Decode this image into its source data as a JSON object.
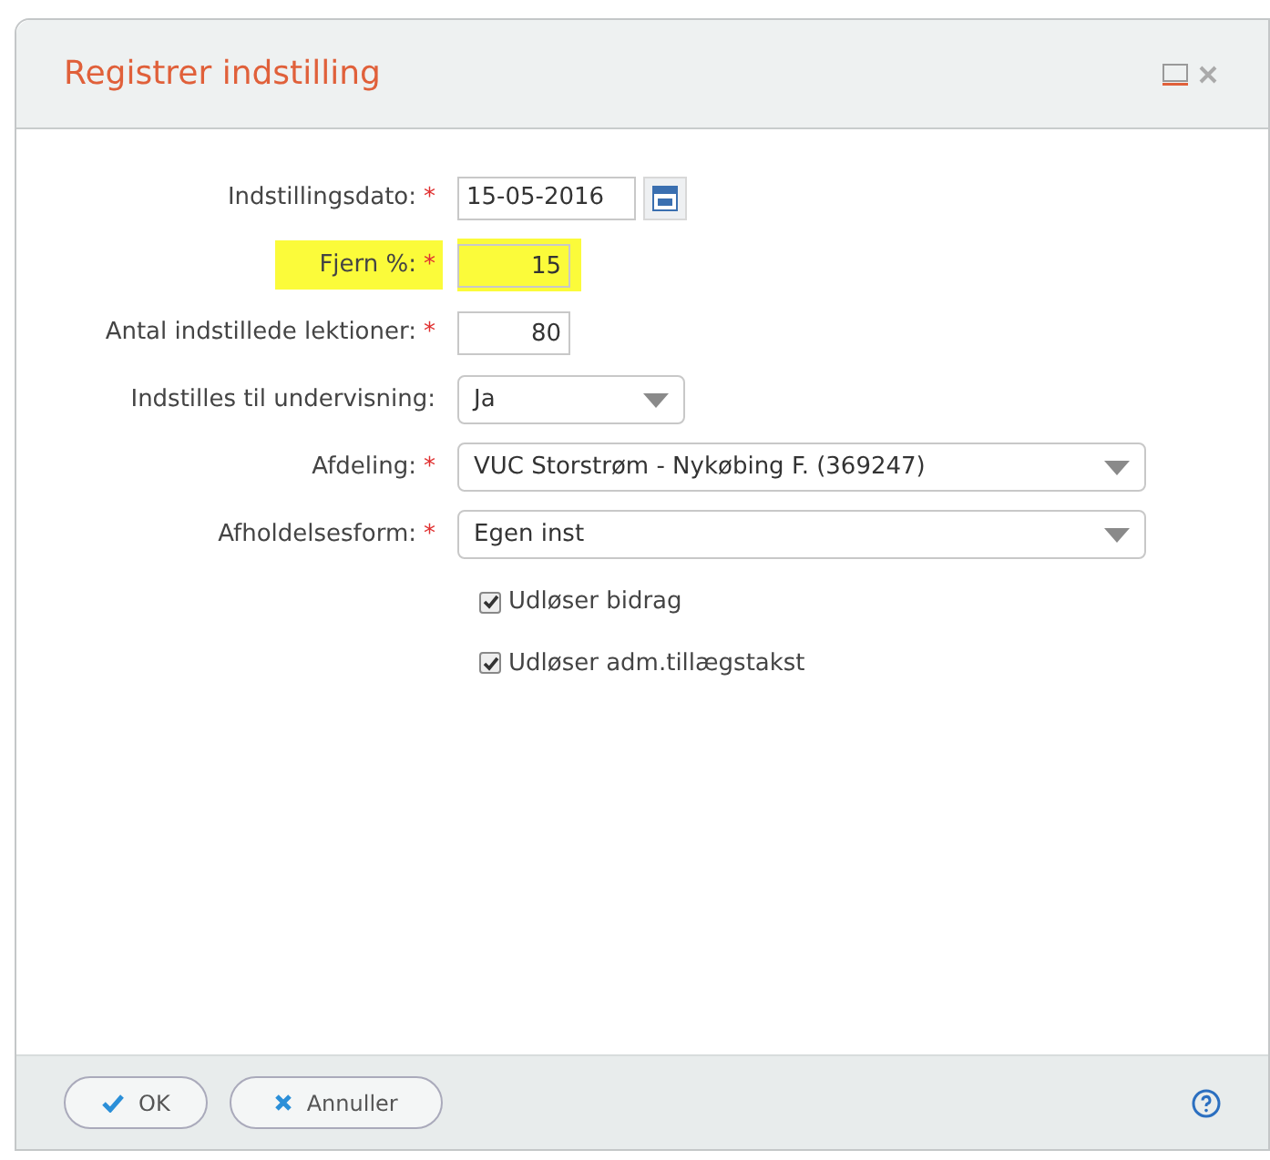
{
  "dialog": {
    "title": "Registrer indstilling"
  },
  "fields": [
    {
      "label": "Indstillingsdato:",
      "required_mark": "*",
      "highlighted": false,
      "kind": "date",
      "value": "15-05-2016"
    },
    {
      "label": "Fjern %:",
      "required_mark": "*",
      "highlighted": true,
      "kind": "number",
      "value": "15"
    },
    {
      "label": "Antal indstillede lektioner:",
      "required_mark": "*",
      "highlighted": false,
      "kind": "number",
      "value": "80"
    },
    {
      "label": "Indstilles til undervisning:",
      "highlighted": false,
      "kind": "short-select",
      "value": "Ja"
    },
    {
      "label": "Afdeling:",
      "required_mark": "*",
      "highlighted": false,
      "kind": "select",
      "value": "VUC Storstrøm - Nykøbing F. (369247)"
    },
    {
      "label": "Afholdelsesform:",
      "required_mark": "*",
      "highlighted": false,
      "kind": "select",
      "value": "Egen inst"
    }
  ],
  "checkboxes": [
    {
      "label": "Udløser bidrag",
      "checked": true
    },
    {
      "label": "Udløser adm.tillægstakst",
      "checked": true
    }
  ],
  "buttons": [
    {
      "label": "OK",
      "kind": "ok"
    },
    {
      "label": "Annuller",
      "kind": "cancel"
    }
  ]
}
